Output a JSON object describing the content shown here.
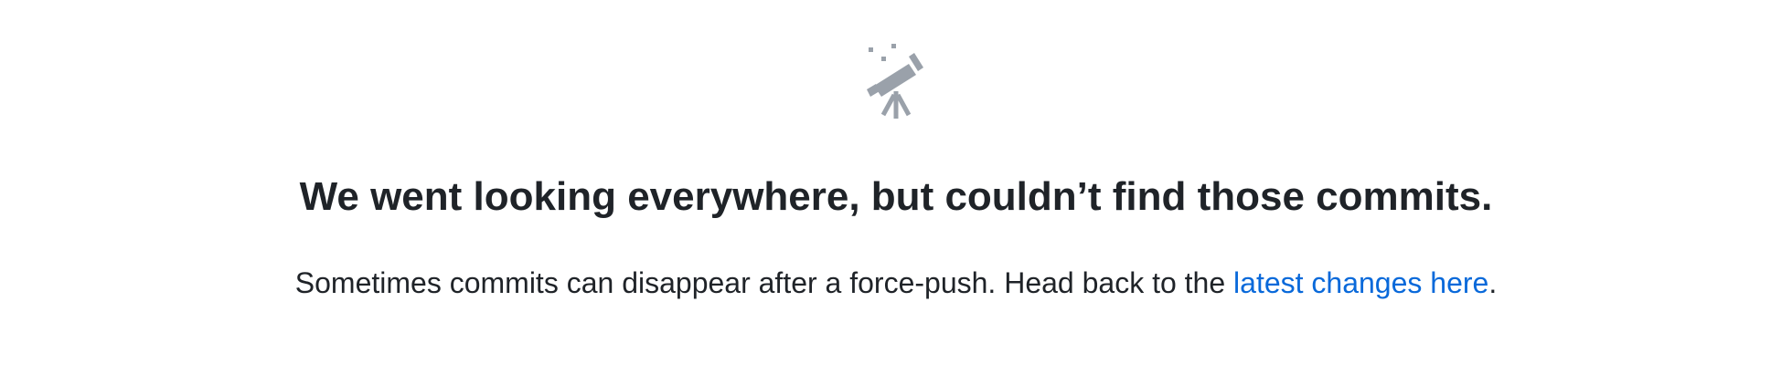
{
  "blankslate": {
    "icon": "telescope-icon",
    "icon_color": "#9aa1aa",
    "title": "We went looking everywhere, but couldn’t find those commits.",
    "message_before": "Sometimes commits can disappear after a force-push. Head back to the ",
    "link_text": "latest changes here",
    "message_after": "."
  },
  "colors": {
    "text": "#1f2328",
    "link": "#0969da",
    "background": "#ffffff"
  }
}
